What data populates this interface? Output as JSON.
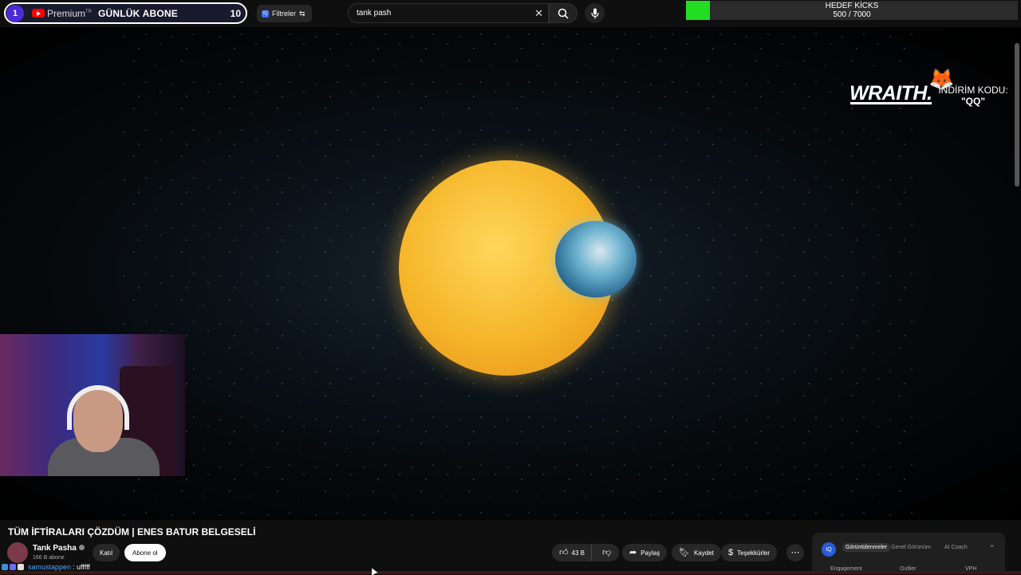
{
  "sub_goal": {
    "left_count": "1",
    "brand": "Premium",
    "brand_sup": "TR",
    "label": "GÜNLÜK ABONE",
    "right_count": "10"
  },
  "filters": {
    "badge": "IQ",
    "label": "Filtreler",
    "icon": "tune-icon"
  },
  "search": {
    "query": "tank pash",
    "clear": "✕"
  },
  "goal": {
    "title": "HEDEF KİCKS",
    "progress_text": "500 / 7000",
    "progress_fraction": 0.0714,
    "fill_color": "#22dd22"
  },
  "sponsor": {
    "brand": "WRAITH.",
    "promo_line1": "İNDİRİM KODU:",
    "promo_line2": "\"QQ\""
  },
  "video": {
    "title": "TÜM İFTİRALARI ÇÖZDÜM | ENES BATUR BELGESELİ",
    "channel": "Tank Pasha",
    "subscribers": "166 B abone",
    "join_label": "Katıl",
    "subscribe_label": "Abone ol",
    "likes": "43 B",
    "share_label": "Paylaş",
    "save_label": "Kaydet",
    "thanks_label": "Teşekkürler"
  },
  "panel": {
    "badge": "IQ",
    "tabs": [
      "Görüntülenmeler",
      "Genel Görünüm",
      "AI Coach"
    ],
    "columns": [
      "Engagement",
      "Outlier",
      "VPH"
    ]
  },
  "chat": {
    "username": "samustappen",
    "message": ": ufffff"
  }
}
